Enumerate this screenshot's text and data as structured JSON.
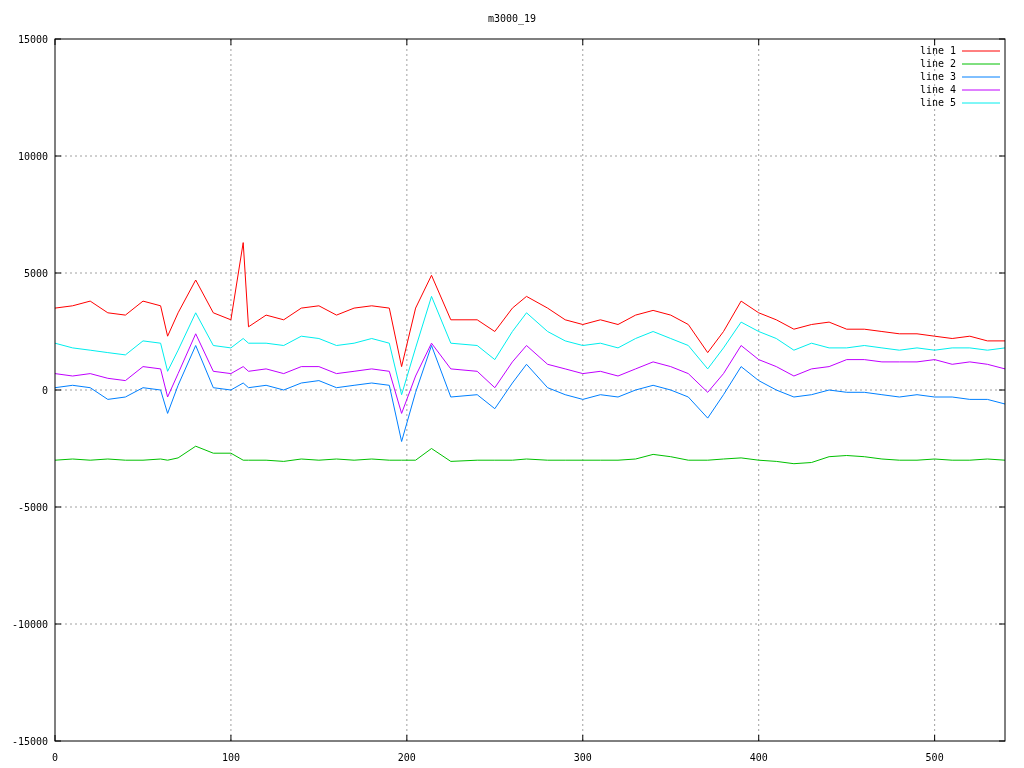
{
  "chart_data": {
    "type": "line",
    "title": "m3000_19",
    "x": [
      0,
      10,
      20,
      30,
      40,
      50,
      60,
      64,
      70,
      80,
      90,
      100,
      107,
      110,
      120,
      130,
      140,
      150,
      160,
      170,
      180,
      190,
      197,
      205,
      214,
      225,
      240,
      250,
      260,
      268,
      280,
      290,
      300,
      310,
      320,
      330,
      340,
      350,
      360,
      371,
      380,
      390,
      400,
      410,
      420,
      430,
      440,
      450,
      460,
      470,
      480,
      490,
      500,
      510,
      520,
      530,
      540
    ],
    "xlim": [
      0,
      540
    ],
    "ylim": [
      -15000,
      15000
    ],
    "xticks": [
      0,
      100,
      200,
      300,
      400,
      500
    ],
    "yticks": [
      -15000,
      -10000,
      -5000,
      0,
      5000,
      10000,
      15000
    ],
    "grid": true,
    "legend": true,
    "series": [
      {
        "name": "line 1",
        "color": "#ff0000",
        "values": [
          3500,
          3600,
          3800,
          3300,
          3200,
          3800,
          3600,
          2300,
          3300,
          4700,
          3300,
          3000,
          6300,
          2700,
          3200,
          3000,
          3500,
          3600,
          3200,
          3500,
          3600,
          3500,
          1000,
          3500,
          4900,
          3000,
          3000,
          2500,
          3500,
          4000,
          3500,
          3000,
          2800,
          3000,
          2800,
          3200,
          3400,
          3200,
          2800,
          1600,
          2500,
          3800,
          3300,
          3000,
          2600,
          2800,
          2900,
          2600,
          2600,
          2500,
          2400,
          2400,
          2300,
          2200,
          2300,
          2100,
          2100
        ]
      },
      {
        "name": "line 2",
        "color": "#00c000",
        "values": [
          -3000,
          -2950,
          -3000,
          -2950,
          -3000,
          -3000,
          -2950,
          -3000,
          -2900,
          -2400,
          -2700,
          -2700,
          -3000,
          -3000,
          -3000,
          -3050,
          -2950,
          -3000,
          -2950,
          -3000,
          -2950,
          -3000,
          -3000,
          -3000,
          -2500,
          -3050,
          -3000,
          -3000,
          -3000,
          -2950,
          -3000,
          -3000,
          -3000,
          -3000,
          -3000,
          -2950,
          -2750,
          -2850,
          -3000,
          -3000,
          -2950,
          -2900,
          -3000,
          -3050,
          -3150,
          -3100,
          -2850,
          -2800,
          -2850,
          -2950,
          -3000,
          -3000,
          -2950,
          -3000,
          -3000,
          -2950,
          -3000
        ]
      },
      {
        "name": "line 3",
        "color": "#0080ff",
        "values": [
          100,
          200,
          100,
          -400,
          -300,
          100,
          0,
          -1000,
          200,
          1900,
          100,
          0,
          300,
          100,
          200,
          0,
          300,
          400,
          100,
          200,
          300,
          200,
          -2200,
          -100,
          1900,
          -300,
          -200,
          -800,
          300,
          1100,
          100,
          -200,
          -400,
          -200,
          -300,
          0,
          200,
          0,
          -300,
          -1200,
          -200,
          1000,
          400,
          0,
          -300,
          -200,
          0,
          -100,
          -100,
          -200,
          -300,
          -200,
          -300,
          -300,
          -400,
          -400,
          -600
        ]
      },
      {
        "name": "line 4",
        "color": "#c000ff",
        "values": [
          700,
          600,
          700,
          500,
          400,
          1000,
          900,
          -300,
          700,
          2400,
          800,
          700,
          1000,
          800,
          900,
          700,
          1000,
          1000,
          700,
          800,
          900,
          800,
          -1000,
          600,
          2000,
          900,
          800,
          100,
          1200,
          1900,
          1100,
          900,
          700,
          800,
          600,
          900,
          1200,
          1000,
          700,
          -100,
          700,
          1900,
          1300,
          1000,
          600,
          900,
          1000,
          1300,
          1300,
          1200,
          1200,
          1200,
          1300,
          1100,
          1200,
          1100,
          900
        ]
      },
      {
        "name": "line 5",
        "color": "#00eeee",
        "values": [
          2000,
          1800,
          1700,
          1600,
          1500,
          2100,
          2000,
          800,
          1700,
          3300,
          1900,
          1800,
          2200,
          2000,
          2000,
          1900,
          2300,
          2200,
          1900,
          2000,
          2200,
          2000,
          -200,
          1800,
          4000,
          2000,
          1900,
          1300,
          2500,
          3300,
          2500,
          2100,
          1900,
          2000,
          1800,
          2200,
          2500,
          2200,
          1900,
          900,
          1800,
          2900,
          2500,
          2200,
          1700,
          2000,
          1800,
          1800,
          1900,
          1800,
          1700,
          1800,
          1700,
          1800,
          1800,
          1700,
          1800
        ]
      }
    ]
  }
}
